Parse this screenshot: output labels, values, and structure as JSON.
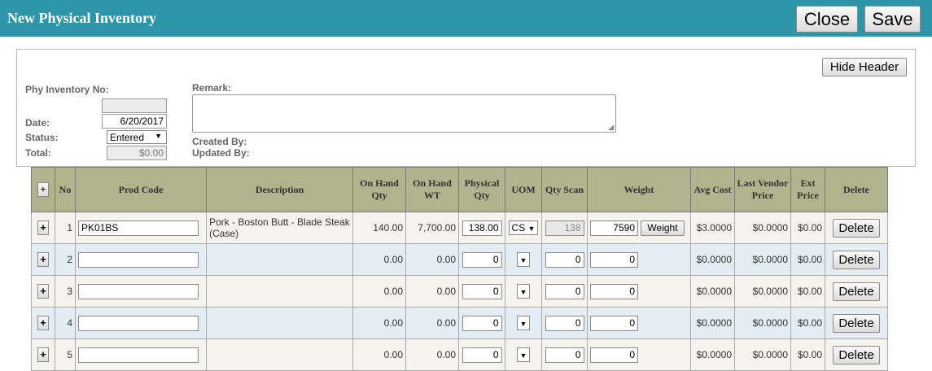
{
  "app": {
    "title": "New Physical Inventory"
  },
  "toolbar": {
    "close_label": "Close",
    "save_label": "Save"
  },
  "header": {
    "hide_header_label": "Hide Header",
    "phy_no_label": "Phy Inventory No:",
    "phy_no_value": "",
    "date_label": "Date:",
    "date_value": "6/20/2017",
    "status_label": "Status:",
    "status_value": "Entered",
    "total_label": "Total:",
    "total_value": "$0.00",
    "remark_label": "Remark:",
    "remark_value": "",
    "created_by_label": "Created By:",
    "updated_by_label": "Updated By:"
  },
  "grid": {
    "headers": {
      "add": "+",
      "no": "No",
      "prod_code": "Prod Code",
      "description": "Description",
      "on_hand_qty": "On Hand Qty",
      "on_hand_wt": "On Hand WT",
      "physical_qty": "Physical Qty",
      "uom": "UOM",
      "qty_scan": "Qty Scan",
      "weight": "Weight",
      "avg_cost": "Avg Cost",
      "last_vendor_price": "Last Vendor Price",
      "ext_price": "Ext Price",
      "delete": "Delete"
    },
    "weight_button_label": "Weight",
    "delete_button_label": "Delete",
    "rows": [
      {
        "plus": "+",
        "no": "1",
        "prod_code": "PK01BS",
        "description": "Pork - Boston Butt - Blade Steak (Case)",
        "on_hand_qty": "140.00",
        "on_hand_wt": "7,700.00",
        "physical_qty": "138.00",
        "uom": "CS",
        "qty_scan": "138",
        "weight": "7590",
        "avg_cost": "$3.0000",
        "last_vendor_price": "$0.0000",
        "ext_price": "$0.00"
      },
      {
        "plus": "+",
        "no": "2",
        "prod_code": "",
        "description": "",
        "on_hand_qty": "0.00",
        "on_hand_wt": "0.00",
        "physical_qty": "0",
        "uom": "",
        "qty_scan": "0",
        "weight": "0",
        "avg_cost": "$0.0000",
        "last_vendor_price": "$0.0000",
        "ext_price": "$0.00"
      },
      {
        "plus": "+",
        "no": "3",
        "prod_code": "",
        "description": "",
        "on_hand_qty": "0.00",
        "on_hand_wt": "0.00",
        "physical_qty": "0",
        "uom": "",
        "qty_scan": "0",
        "weight": "0",
        "avg_cost": "$0.0000",
        "last_vendor_price": "$0.0000",
        "ext_price": "$0.00"
      },
      {
        "plus": "+",
        "no": "4",
        "prod_code": "",
        "description": "",
        "on_hand_qty": "0.00",
        "on_hand_wt": "0.00",
        "physical_qty": "0",
        "uom": "",
        "qty_scan": "0",
        "weight": "0",
        "avg_cost": "$0.0000",
        "last_vendor_price": "$0.0000",
        "ext_price": "$0.00"
      },
      {
        "plus": "+",
        "no": "5",
        "prod_code": "",
        "description": "",
        "on_hand_qty": "0.00",
        "on_hand_wt": "0.00",
        "physical_qty": "0",
        "uom": "",
        "qty_scan": "0",
        "weight": "0",
        "avg_cost": "$0.0000",
        "last_vendor_price": "$0.0000",
        "ext_price": "$0.00"
      }
    ]
  }
}
